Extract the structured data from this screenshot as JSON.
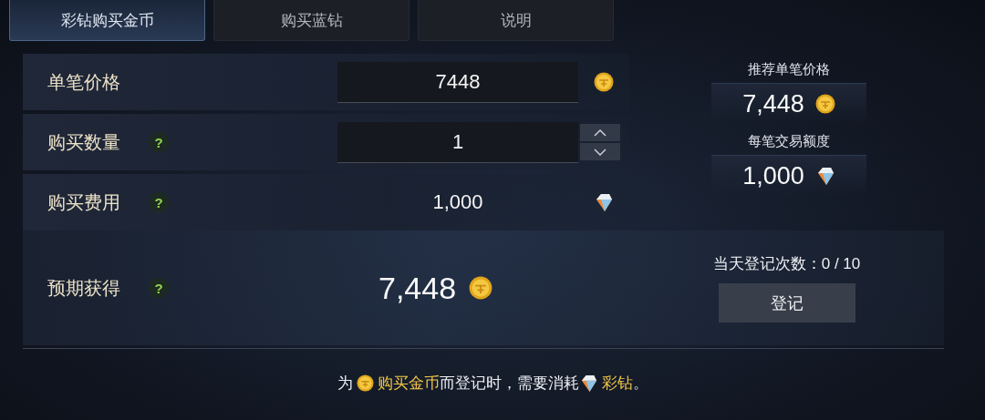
{
  "tabs": [
    {
      "label": "彩钻购买金币",
      "selected": true
    },
    {
      "label": "购买蓝钻",
      "selected": false
    },
    {
      "label": "说明",
      "selected": false
    }
  ],
  "rows": [
    {
      "kind": "input",
      "label": "单笔价格",
      "value": "7448",
      "currency": {
        "kind": "coin"
      }
    },
    {
      "kind": "stepper",
      "label": "购买数量",
      "help": "?",
      "value": "1"
    },
    {
      "kind": "plain",
      "label": "购买费用",
      "help": "?",
      "value": "1,000",
      "currency": {
        "kind": "diamond"
      }
    }
  ],
  "side": [
    {
      "label": "推荐单笔价格",
      "value": "7,448",
      "currency": {
        "kind": "coin"
      }
    },
    {
      "label": "每笔交易额度",
      "value": "1,000",
      "currency": {
        "kind": "diamond"
      }
    }
  ],
  "summary": {
    "label": "预期获得",
    "help": "?",
    "value": "7,448",
    "currency": {
      "kind": "coin"
    }
  },
  "daily_count": "当天登记次数：0 / 10",
  "register_button": "登记",
  "footer": [
    {
      "kind": "text",
      "text": "为"
    },
    {
      "kind": "coin"
    },
    {
      "kind": "highlight",
      "text": "购买金币"
    },
    {
      "kind": "text",
      "text": "而登记时，需要消耗"
    },
    {
      "kind": "diamond"
    },
    {
      "kind": "highlight",
      "text": "彩钻"
    },
    {
      "kind": "text",
      "text": "。"
    }
  ]
}
